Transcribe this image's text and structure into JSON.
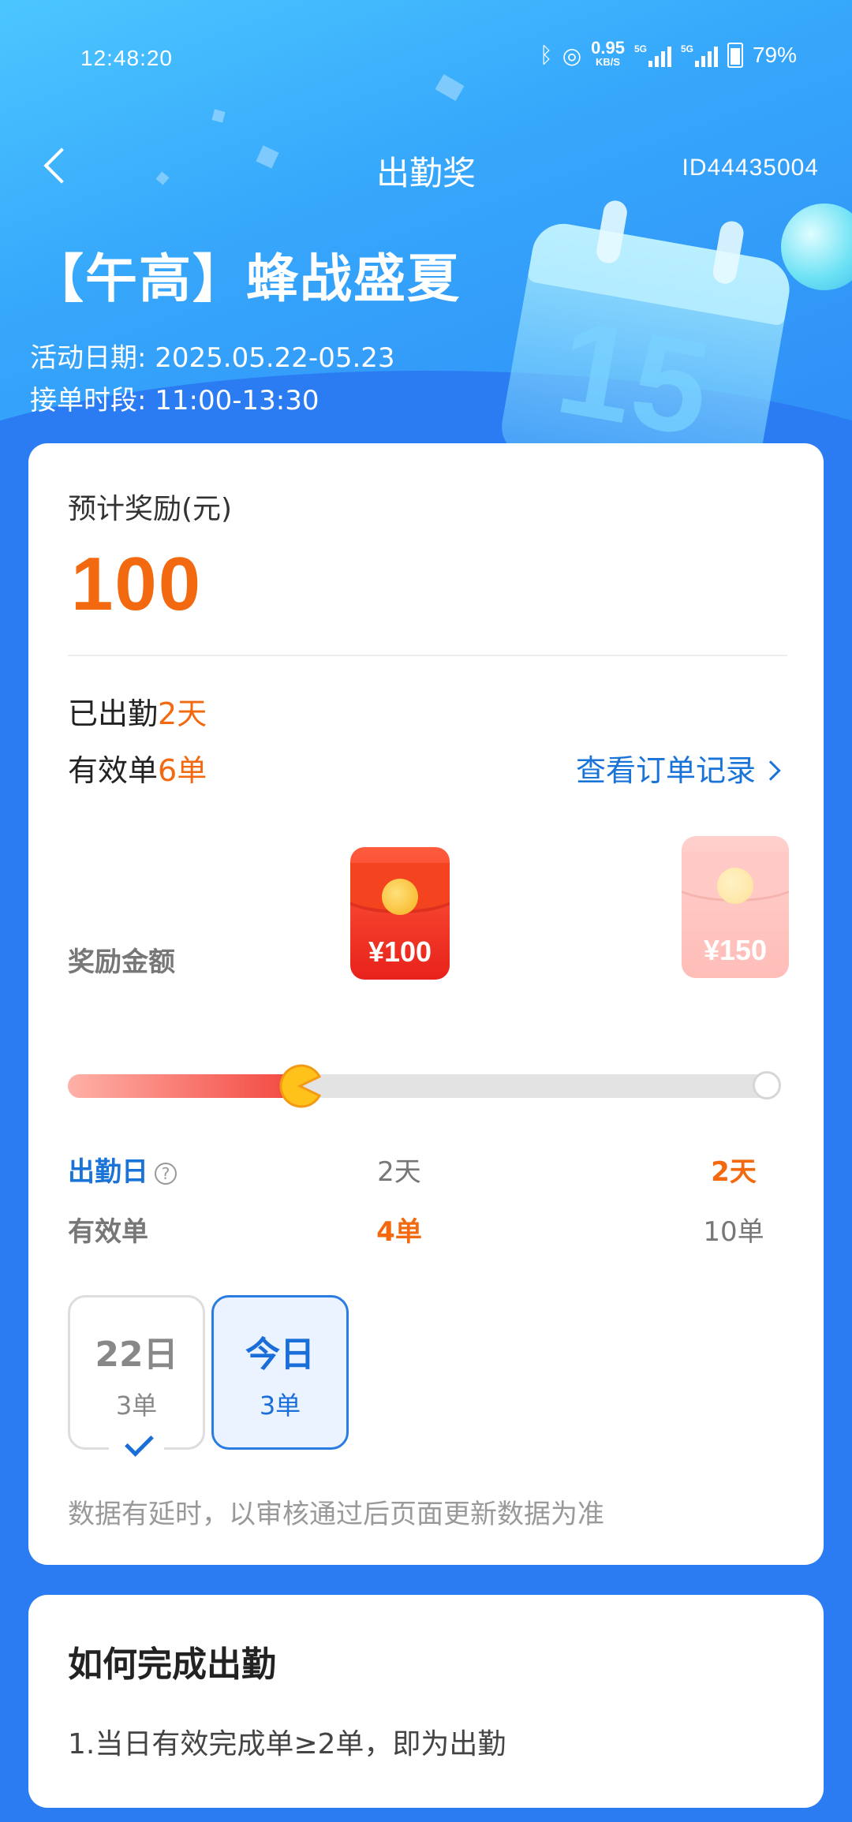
{
  "status_bar": {
    "time": "12:48:20",
    "net_speed": "0.95",
    "net_unit": "KB/S",
    "sig1": "5G",
    "sig2": "5G",
    "battery": "79%"
  },
  "nav": {
    "title": "出勤奖",
    "id": "ID44435004"
  },
  "event": {
    "title": "【午高】蜂战盛夏",
    "date_line": "活动日期: 2025.05.22-05.23",
    "time_line": "接单时段: 11:00-13:30",
    "calendar_number": "15"
  },
  "reward": {
    "label": "预计奖励(元)",
    "amount": "100"
  },
  "stats": {
    "days_prefix": "已出勤",
    "days_value": "2天",
    "orders_prefix": "有效单",
    "orders_value": "6单",
    "record_link": "查看订单记录"
  },
  "progress": {
    "prize_label": "奖励金额",
    "tiers": [
      {
        "amount": "¥100",
        "days": "2天",
        "orders": "4单",
        "achieved": true
      },
      {
        "amount": "¥150",
        "days": "2天",
        "orders": "10单",
        "achieved": false
      }
    ],
    "fill_fraction": 0.31,
    "row_days_label": "出勤日",
    "row_orders_label": "有效单",
    "help_glyph": "?"
  },
  "day_tabs": [
    {
      "day": "22日",
      "count": "3单",
      "checked": true
    },
    {
      "day": "今日",
      "count": "3单",
      "selected": true
    }
  ],
  "note": "数据有延时，以审核通过后页面更新数据为准",
  "how_to": {
    "title": "如何完成出勤",
    "rule": "1.当日有效完成单≥2单，即为出勤"
  },
  "colors": {
    "accent_orange": "#f2690f",
    "link_blue": "#1a74d8",
    "background_blue": "#2b7cf3"
  }
}
